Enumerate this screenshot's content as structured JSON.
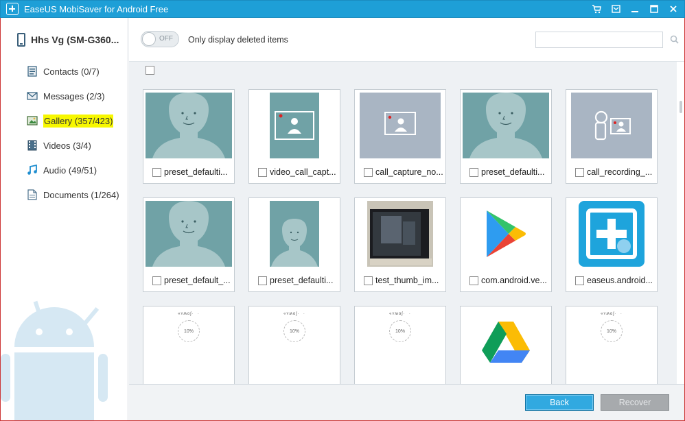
{
  "window": {
    "title": "EaseUS MobiSaver for Android Free",
    "controls": [
      "cart-icon",
      "feedback-icon",
      "minimize-icon",
      "maximize-icon",
      "close-icon"
    ]
  },
  "sidebar": {
    "device_name": "Hhs Vg (SM-G360...",
    "items": [
      {
        "label": "Contacts",
        "count": "(0/7)",
        "icon": "contacts-icon"
      },
      {
        "label": "Messages",
        "count": "(2/3)",
        "icon": "messages-icon"
      },
      {
        "label": "Gallery",
        "count": "(357/423)",
        "icon": "gallery-icon",
        "highlighted": true
      },
      {
        "label": "Videos",
        "count": "(3/4)",
        "icon": "videos-icon"
      },
      {
        "label": "Audio",
        "count": "(49/51)",
        "icon": "audio-icon"
      },
      {
        "label": "Documents",
        "count": "(1/264)",
        "icon": "documents-icon"
      }
    ]
  },
  "toolbar": {
    "toggle_state": "OFF",
    "toggle_label": "Only display deleted items",
    "search_placeholder": ""
  },
  "gallery": {
    "items": [
      {
        "name": "preset_defaulti...",
        "thumb": "avatar-large"
      },
      {
        "name": "video_call_capt...",
        "thumb": "video-call-capture"
      },
      {
        "name": "call_capture_no...",
        "thumb": "call-capture"
      },
      {
        "name": "preset_defaulti...",
        "thumb": "avatar-large"
      },
      {
        "name": "call_recording_...",
        "thumb": "call-recording"
      },
      {
        "name": "preset_default_...",
        "thumb": "avatar-large"
      },
      {
        "name": "preset_defaulti...",
        "thumb": "avatar-small"
      },
      {
        "name": "test_thumb_im...",
        "thumb": "photo"
      },
      {
        "name": "com.android.ve...",
        "thumb": "play-store"
      },
      {
        "name": "easeus.android...",
        "thumb": "easeus-logo"
      },
      {
        "name": "",
        "thumb": "loading",
        "loading_text": "10%"
      },
      {
        "name": "",
        "thumb": "loading",
        "loading_text": "10%"
      },
      {
        "name": "",
        "thumb": "loading",
        "loading_text": "10%"
      },
      {
        "name": "",
        "thumb": "drive"
      },
      {
        "name": "",
        "thumb": "loading",
        "loading_text": "10%"
      }
    ]
  },
  "footer": {
    "back_label": "Back",
    "recover_label": "Recover"
  }
}
